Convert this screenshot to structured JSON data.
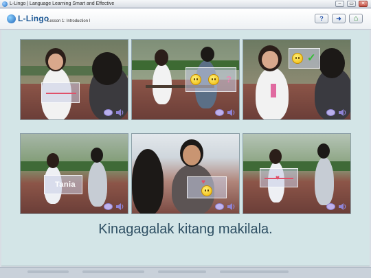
{
  "window": {
    "title": "L-Lingo | Language Learning Smart and Effective",
    "controls": {
      "minimize": "–",
      "maximize": "▭",
      "close": "✕"
    }
  },
  "header": {
    "logo_text": "L-Lingo",
    "lesson": "Lesson 1: Introduction I",
    "buttons": {
      "help": {
        "icon": "help-icon",
        "glyph": "?",
        "color": "#1f4fa8"
      },
      "next": {
        "icon": "next-arrow-icon",
        "glyph": "➜",
        "color": "#1f4fa8"
      },
      "home": {
        "icon": "home-icon",
        "glyph": "⌂",
        "color": "#2f8a2f"
      }
    }
  },
  "panels": [
    {
      "id": "panel-1",
      "overlay": "arrow"
    },
    {
      "id": "panel-2",
      "overlay": "smileys-question"
    },
    {
      "id": "panel-3",
      "overlay": "smiley-check"
    },
    {
      "id": "panel-4",
      "overlay": "name-tag",
      "name_tag": "Tania"
    },
    {
      "id": "panel-5",
      "overlay": "smiley-hearts"
    },
    {
      "id": "panel-6",
      "overlay": "arrow-heart"
    }
  ],
  "sentence": "Kinagagalak kitang makilala.",
  "colors": {
    "content_bg": "#d3e5e7",
    "sentence": "#2e4f63",
    "accent_pink": "#e0516a"
  }
}
